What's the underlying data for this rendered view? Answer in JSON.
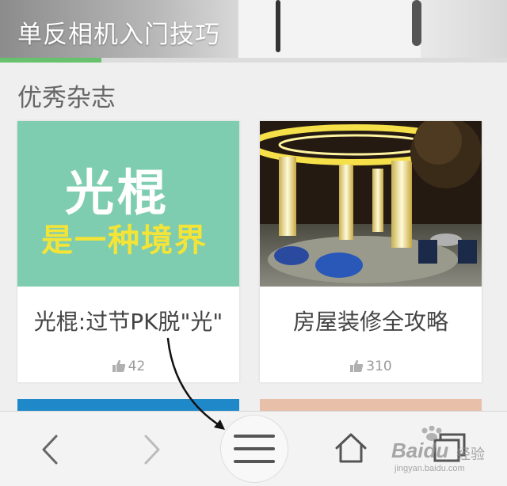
{
  "banner": {
    "title": "单反相机入门技巧",
    "progress_fraction": 0.2
  },
  "section": {
    "title": "优秀杂志"
  },
  "cards": [
    {
      "image_headline": "光棍",
      "image_subline": "是一种境界",
      "title": "光棍:过节PK脱\"光\"",
      "likes": "42"
    },
    {
      "title": "房屋装修全攻略",
      "likes": "310"
    }
  ],
  "toolbar": {
    "items": [
      "back-icon",
      "forward-icon",
      "menu-icon",
      "home-icon",
      "tabs-icon"
    ]
  },
  "watermark": {
    "brand": "Baidu",
    "cn": "经验",
    "url": "jingyan.baidu.com"
  }
}
